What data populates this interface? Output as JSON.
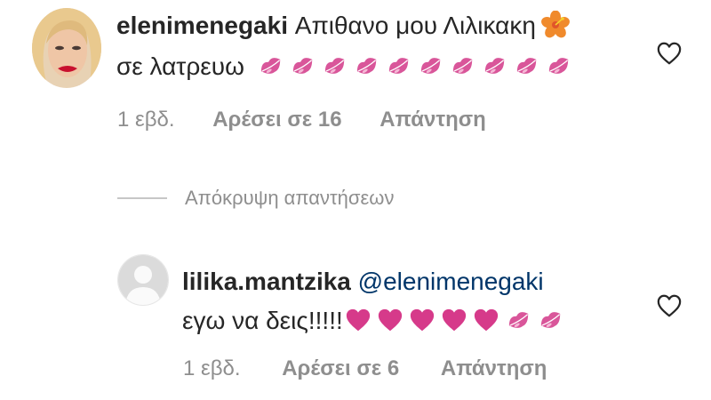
{
  "comment": {
    "username": "elenimenegaki",
    "text_line1": "Απιθανο μου Λιλικακη",
    "text_line2": "σε λατρευω",
    "time": "1 εβδ.",
    "likes": "Αρέσει σε 16",
    "reply": "Απάντηση",
    "emoji": [
      "hibiscus",
      "kiss x10"
    ]
  },
  "hide_replies": "Απόκρυψη απαντήσεων",
  "reply": {
    "username": "lilika.mantzika",
    "mention": "@elenimenegaki",
    "text": "εγω να δεις!!!!!",
    "time": "1 εβδ.",
    "likes": "Αρέσει σε 6",
    "reply": "Απάντηση",
    "emoji": [
      "heart x5",
      "kiss x2"
    ]
  },
  "colors": {
    "text": "#262626",
    "meta": "#8e8e8e",
    "mention": "#003569",
    "kiss": "#d9569a",
    "heart": "#d63a8a",
    "hibiscus": "#f08a2c"
  }
}
